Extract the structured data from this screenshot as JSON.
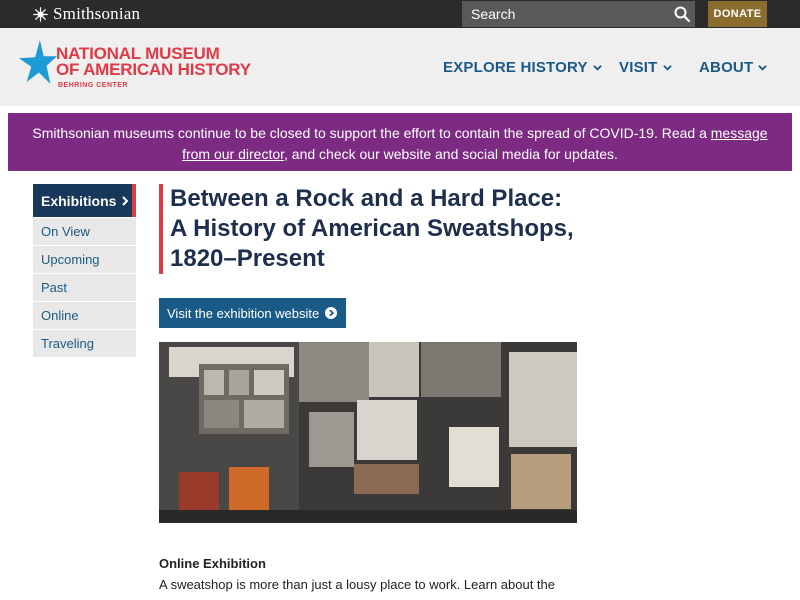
{
  "topbar": {
    "logo_text": "Smithsonian",
    "search_placeholder": "Search",
    "donate_label": "DONATE"
  },
  "header": {
    "title_line1": "NATIONAL MUSEUM",
    "title_line2": "OF AMERICAN HISTORY",
    "subtitle": "BEHRING CENTER",
    "nav": [
      "EXPLORE HISTORY",
      "VISIT",
      "ABOUT"
    ]
  },
  "banner": {
    "text_before": "Smithsonian museums continue to be closed to support the effort to contain the spread of COVID-19. Read a ",
    "link_text": "message from our director",
    "text_after": ", and check our website and social media for updates."
  },
  "sidebar": {
    "heading": "Exhibitions",
    "items": [
      "On View",
      "Upcoming",
      "Past",
      "Online",
      "Traveling"
    ]
  },
  "main": {
    "title": "Between a Rock and a Hard Place: A History of American Sweatshops, 1820–Present",
    "visit_button": "Visit the exhibition website",
    "section_heading": "Online Exhibition",
    "body_text": "A sweatshop is more than just a lousy place to work. Learn about the"
  },
  "colors": {
    "accent_red": "#e03a47",
    "nav_blue": "#1a5a86",
    "dark_navy": "#17385a",
    "banner_purple": "#7d2a83",
    "donate_gold": "#8a6c2e"
  },
  "icons": [
    "smithsonian-sun-icon",
    "search-icon",
    "star-icon",
    "chevron-down-icon",
    "chevron-right-icon",
    "arrow-circle-icon"
  ]
}
